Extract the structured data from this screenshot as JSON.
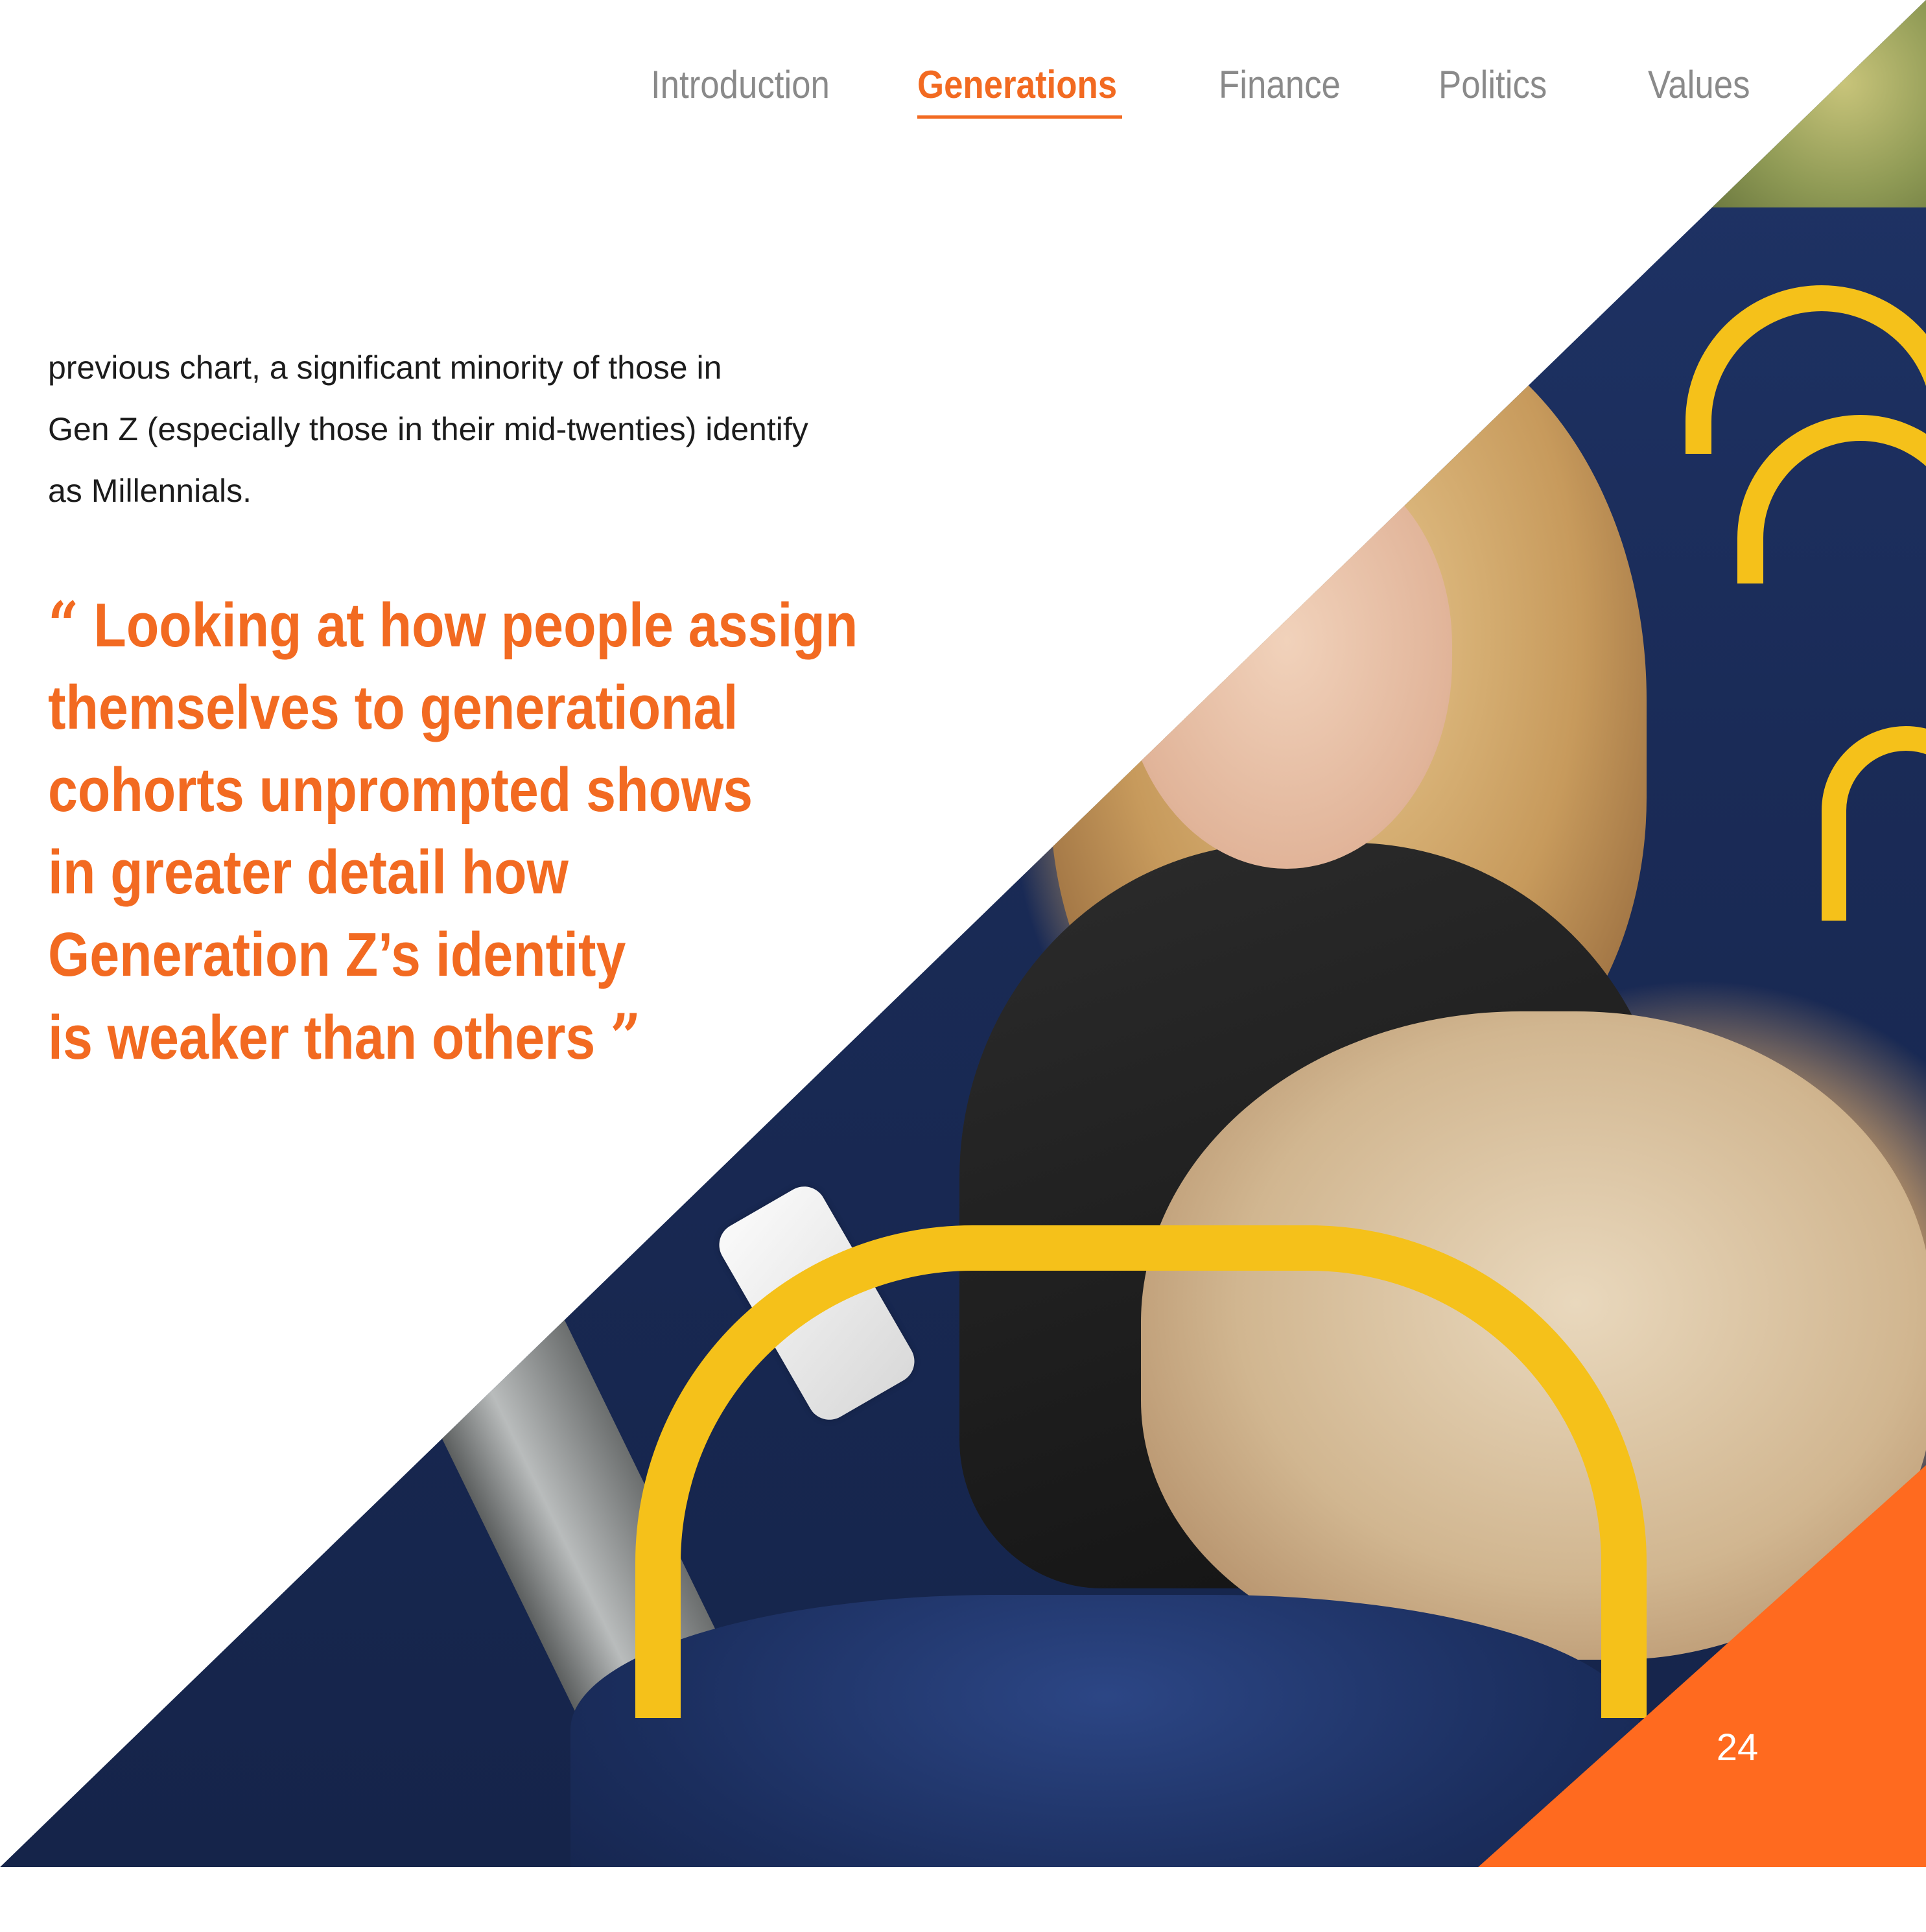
{
  "nav": {
    "items": [
      {
        "label": "Introduction",
        "active": false
      },
      {
        "label": "Generations",
        "active": true
      },
      {
        "label": "Finance",
        "active": false
      },
      {
        "label": "Politics",
        "active": false
      },
      {
        "label": "Values",
        "active": false
      }
    ]
  },
  "body": {
    "lines": [
      "previous chart, a significant minority of those in",
      "Gen Z (especially those in their mid-twenties) identify",
      "as Millennials."
    ]
  },
  "quote": {
    "open_mark": "“",
    "close_mark": "”",
    "lines": [
      "Looking at how people assign",
      "themselves to generational",
      "cohorts unprompted shows",
      "in greater detail how",
      "Generation Z’s identity",
      "is weaker than others"
    ]
  },
  "page_number": "24",
  "colors": {
    "accent": "#f26a21",
    "corner": "#ff6a1f",
    "nav_inactive": "#8a8a8a",
    "body_text": "#1c1c1c"
  }
}
